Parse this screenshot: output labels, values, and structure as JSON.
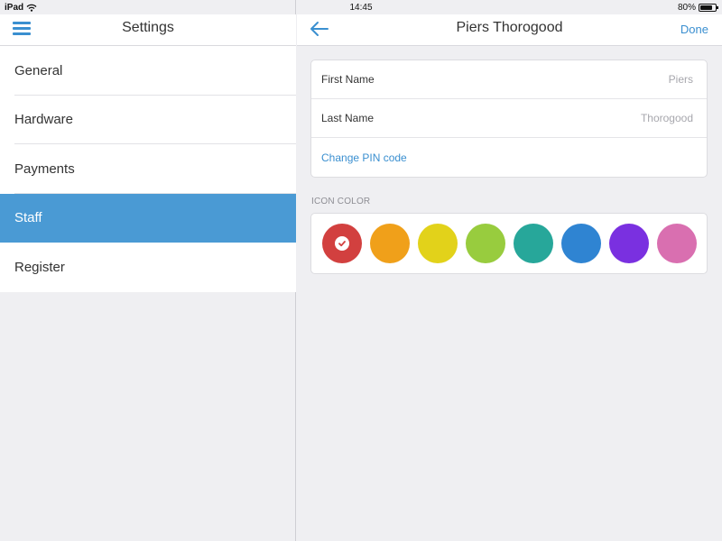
{
  "status_bar": {
    "device": "iPad",
    "time": "14:45",
    "battery": "80%",
    "battery_level": 0.8
  },
  "sidebar": {
    "title": "Settings",
    "items": [
      {
        "label": "General",
        "selected": false
      },
      {
        "label": "Hardware",
        "selected": false
      },
      {
        "label": "Payments",
        "selected": false
      },
      {
        "label": "Staff",
        "selected": true
      },
      {
        "label": "Register",
        "selected": false
      }
    ]
  },
  "detail": {
    "title": "Piers Thorogood",
    "done_label": "Done",
    "fields": [
      {
        "label": "First Name",
        "value": "Piers"
      },
      {
        "label": "Last Name",
        "value": "Thorogood"
      }
    ],
    "change_pin_label": "Change PIN code",
    "icon_color_heading": "ICON COLOR",
    "icon_colors": [
      {
        "name": "red",
        "hex": "#d2403f",
        "selected": true
      },
      {
        "name": "orange",
        "hex": "#f0a01a",
        "selected": false
      },
      {
        "name": "yellow",
        "hex": "#e2d21a",
        "selected": false
      },
      {
        "name": "green",
        "hex": "#98cc3e",
        "selected": false
      },
      {
        "name": "teal",
        "hex": "#27a79a",
        "selected": false
      },
      {
        "name": "blue",
        "hex": "#2f84d2",
        "selected": false
      },
      {
        "name": "purple",
        "hex": "#7a30e0",
        "selected": false
      },
      {
        "name": "pink",
        "hex": "#d96fb0",
        "selected": false
      }
    ]
  },
  "accent_color": "#3a8fd0",
  "selected_row_color": "#4a9ad4"
}
